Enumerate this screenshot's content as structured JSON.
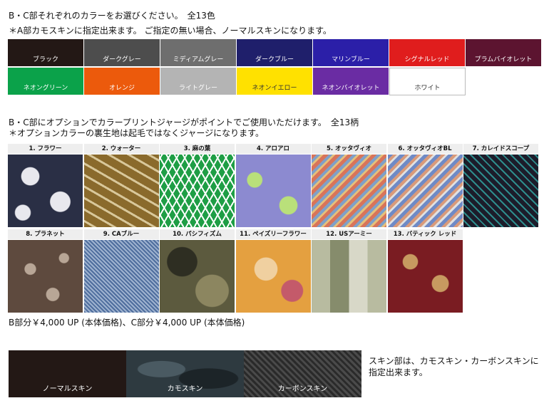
{
  "header": {
    "line1": "B・C部それぞれのカラーをお選びください。　全13色",
    "line2": "＊A部カモスキンに指定出来ます。 ご指定の無い場合、ノーマルスキンになります。"
  },
  "colors": [
    {
      "label": "ブラック",
      "bg": "#231815",
      "fg": "#ffffff"
    },
    {
      "label": "ダークグレー",
      "bg": "#4d4d4d",
      "fg": "#ffffff"
    },
    {
      "label": "ミディアムグレー",
      "bg": "#6e6e6e",
      "fg": "#ffffff"
    },
    {
      "label": "ダークブルー",
      "bg": "#1f1f6b",
      "fg": "#ffffff"
    },
    {
      "label": "マリンブルー",
      "bg": "#2b1fa8",
      "fg": "#ffffff"
    },
    {
      "label": "シグナルレッド",
      "bg": "#e01d1d",
      "fg": "#ffffff"
    },
    {
      "label": "プラムバイオレット",
      "bg": "#5c1430",
      "fg": "#ffffff"
    },
    {
      "label": "ネオングリーン",
      "bg": "#0ba24a",
      "fg": "#ffffff"
    },
    {
      "label": "オレンジ",
      "bg": "#ec5a0c",
      "fg": "#ffffff"
    },
    {
      "label": "ライトグレー",
      "bg": "#b4b4b4",
      "fg": "#ffffff"
    },
    {
      "label": "ネオンイエロー",
      "bg": "#ffe100",
      "fg": "#333333"
    },
    {
      "label": "ネオンバイオレット",
      "bg": "#6a2ca3",
      "fg": "#ffffff"
    },
    {
      "label": "ホワイト",
      "bg": "#ffffff",
      "fg": "#333333"
    }
  ],
  "options": {
    "line1": "B・C部にオプションでカラープリントジャージがポイントでご使用いただけます。　全13柄",
    "line2": "＊オプションカラーの裏生地は起毛ではなくジャージになります。"
  },
  "patterns": [
    {
      "label": "1. フラワー",
      "fill": "#2a2f45",
      "fill2": "#e8e8ee"
    },
    {
      "label": "2. ウォーター",
      "fill": "#8a6a2c",
      "fill2": "#d8c79a"
    },
    {
      "label": "3. 麻の葉",
      "fill": "#1e9e45",
      "fill2": "#ffffff"
    },
    {
      "label": "4. アロアロ",
      "fill": "#8c8ad0",
      "fill2": "#b9e07a"
    },
    {
      "label": "5. オッタヴィオ",
      "fill": "#d8745a",
      "fill2": "#7fa0c8"
    },
    {
      "label": "6. オッタヴィオBL",
      "fill": "#6f8ac6",
      "fill2": "#d99a7a"
    },
    {
      "label": "7. カレイドスコープ",
      "fill": "#1c1c2a",
      "fill2": "#2e8c8c"
    },
    {
      "label": "8. プラネット",
      "fill": "#5e4a3e",
      "fill2": "#b8a696"
    },
    {
      "label": "9. CAブルー",
      "fill": "#4f6e9e",
      "fill2": "#9eb2cf"
    },
    {
      "label": "10. パシフィズム",
      "fill": "#5c5a3e",
      "fill2": "#2e2e22"
    },
    {
      "label": "11. ペイズリーフラワー",
      "fill": "#e4a040",
      "fill2": "#f0d0a0"
    },
    {
      "label": "12. USアーミー",
      "fill": "#b8bba0",
      "fill2": "#868c6c"
    },
    {
      "label": "13. バティック レッド",
      "fill": "#7a1c22",
      "fill2": "#c79a60"
    }
  ],
  "price": "B部分￥4,000 UP (本体価格)、C部分￥4,000 UP (本体価格)",
  "skins": [
    {
      "label": "ノーマルスキン",
      "bg": "#231815"
    },
    {
      "label": "カモスキン",
      "bg": "#2e3a40"
    },
    {
      "label": "カーボンスキン",
      "bg": "#3c3c3c"
    }
  ],
  "skin_note": {
    "line1": "スキン部は、カモスキン・カーボンスキンに",
    "line2": "指定出来ます。"
  }
}
